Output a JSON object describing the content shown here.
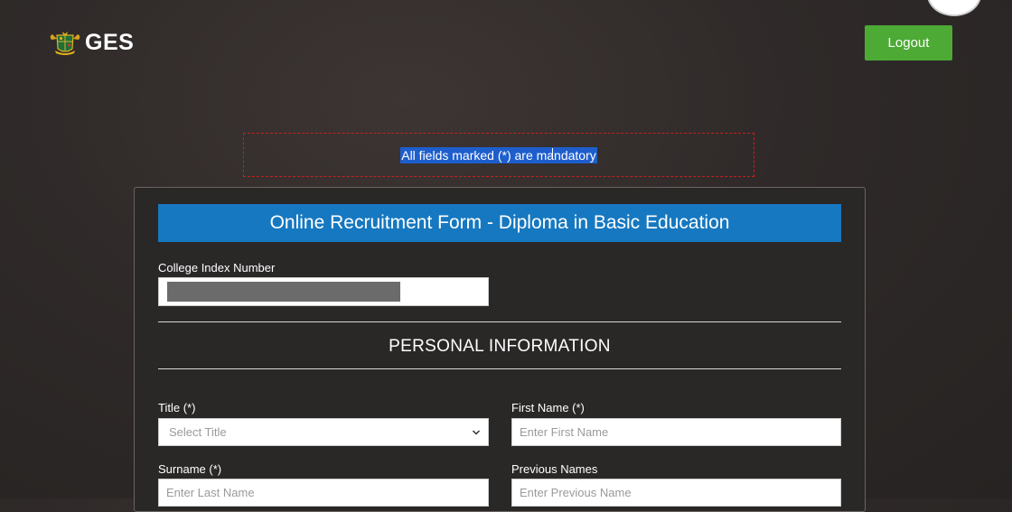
{
  "header": {
    "logo_text": "GES",
    "logout_label": "Logout"
  },
  "notice": {
    "text": "All fields marked (*) are mandatory"
  },
  "form": {
    "title": "Online Recruitment Form - Diploma in Basic Education",
    "college_index_label": "College Index Number",
    "section_heading": "PERSONAL INFORMATION",
    "title_field": {
      "label": "Title (*)",
      "selected": "Select Title"
    },
    "first_name": {
      "label": "First Name (*)",
      "placeholder": "Enter First Name"
    },
    "surname": {
      "label": "Surname (*)",
      "placeholder": "Enter Last Name"
    },
    "previous_names": {
      "label": "Previous Names",
      "placeholder": "Enter Previous Name"
    }
  },
  "colors": {
    "title_bar": "#1678c0",
    "logout_button": "#4caa35",
    "notice_border": "#c32020",
    "selection_highlight": "#1e5ecc"
  },
  "icons": {
    "logo": "ghana-coat-of-arms-icon",
    "select_arrow": "chevron-down-icon"
  }
}
